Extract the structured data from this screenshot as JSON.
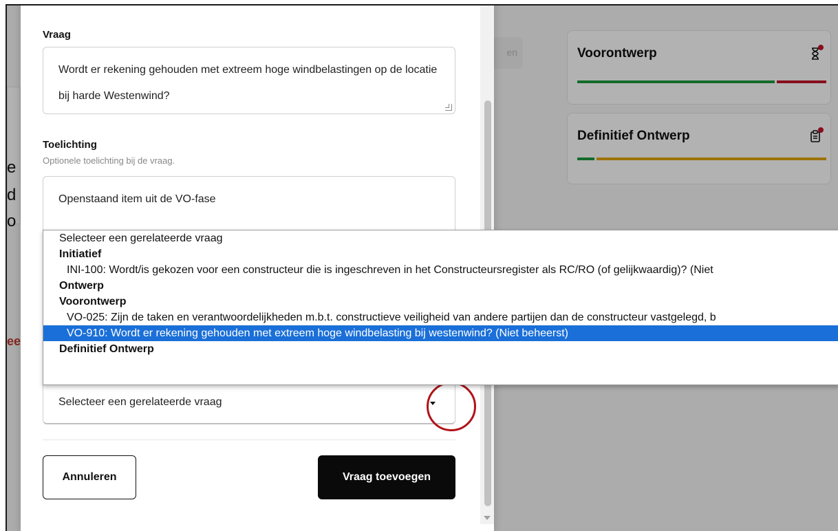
{
  "background": {
    "cut_texts": [
      "e",
      "d",
      "o"
    ],
    "cut_red_text": "ee",
    "button_partial": "en",
    "phases": [
      {
        "title": "Voorontwerp",
        "icon": "hourglass-icon",
        "progress": [
          {
            "color": "#1e9a3e",
            "fraction": 0.8
          },
          {
            "color": "#c0152a",
            "fraction": 0.2
          }
        ]
      },
      {
        "title": "Definitief Ontwerp",
        "icon": "clipboard-icon",
        "progress": [
          {
            "color": "#1e9a3e",
            "fraction": 0.07
          },
          {
            "color": "#e0a400",
            "fraction": 0.93
          }
        ]
      }
    ]
  },
  "modal": {
    "question_label": "Vraag",
    "question_value": "Wordt er rekening gehouden met extreem hoge windbelastingen op de locatie bij harde Westenwind?",
    "explanation_label": "Toelichting",
    "explanation_hint": "Optionele toelichting bij de vraag.",
    "explanation_value": "Openstaand item uit de VO-fase",
    "related_select": {
      "value": "Selecteer een gerelateerde vraag",
      "options": [
        {
          "label": "Selecteer een gerelateerde vraag",
          "kind": "placeholder"
        },
        {
          "label": "Initiatief",
          "kind": "group"
        },
        {
          "label": "INI-100: Wordt/is gekozen voor een constructeur die is ingeschreven in het Constructeursregister als RC/RO (of gelijkwaardig)? (Niet",
          "kind": "child"
        },
        {
          "label": "Ontwerp",
          "kind": "group"
        },
        {
          "label": "Voorontwerp",
          "kind": "group"
        },
        {
          "label": "VO-025: Zijn de taken en verantwoordelijkheden m.b.t. constructieve veiligheid van andere partijen dan de constructeur vastgelegd, b",
          "kind": "child"
        },
        {
          "label": "VO-910: Wordt er rekening gehouden met extreem hoge windbelasting bij westenwind? (Niet beheerst)",
          "kind": "child",
          "selected": true
        },
        {
          "label": "Definitief Ontwerp",
          "kind": "group"
        }
      ]
    },
    "cancel_label": "Annuleren",
    "submit_label": "Vraag toevoegen"
  },
  "colors": {
    "accent_selected": "#1a6fd8",
    "annotation_circle": "#b01319"
  }
}
